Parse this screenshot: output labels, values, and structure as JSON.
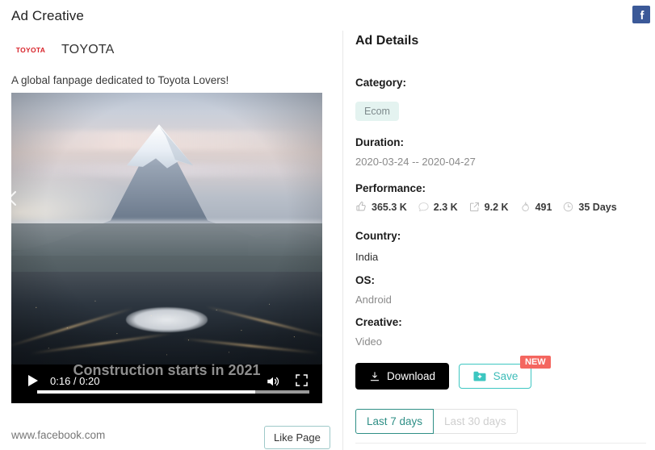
{
  "header": {
    "title": "Ad Creative",
    "social_icon": "facebook-icon"
  },
  "ad_creative": {
    "brand_logo_text": "TOYOTA",
    "brand_name": "TOYOTA",
    "ad_copy": "A global fanpage dedicated to Toyota Lovers!",
    "video": {
      "caption": "Construction starts in 2021",
      "current_time": "0:16",
      "duration": "0:20",
      "time_display": "0:16 / 0:20",
      "progress_percent": 80,
      "play_icon": "play-icon",
      "volume_icon": "volume-icon",
      "fullscreen_icon": "fullscreen-icon"
    },
    "footer": {
      "site_url": "www.facebook.com",
      "cta_label": "Like Page"
    },
    "carousel_prev_icon": "chevron-left-icon"
  },
  "ad_details": {
    "title": "Ad Details",
    "fields": {
      "category_label": "Category:",
      "category_value": "Ecom",
      "duration_label": "Duration:",
      "duration_value": "2020-03-24 -- 2020-04-27",
      "performance_label": "Performance:",
      "country_label": "Country:",
      "country_value": "India",
      "os_label": "OS:",
      "os_value": "Android",
      "creative_label": "Creative:",
      "creative_value": "Video"
    },
    "performance": [
      {
        "icon": "thumbs-up-icon",
        "value": "365.3 K"
      },
      {
        "icon": "comment-icon",
        "value": "2.3 K"
      },
      {
        "icon": "share-icon",
        "value": "9.2 K"
      },
      {
        "icon": "fire-icon",
        "value": "491"
      },
      {
        "icon": "clock-icon",
        "value": "35 Days"
      }
    ],
    "actions": {
      "download_label": "Download",
      "download_icon": "download-icon",
      "save_label": "Save",
      "save_icon": "folder-plus-icon",
      "new_badge": "NEW"
    },
    "date_range": {
      "option_active": "Last 7 days",
      "option_inactive": "Last 30 days"
    }
  },
  "colors": {
    "accent_teal": "#3cbcb8",
    "accent_dark_teal": "#2f8f86",
    "badge_red": "#f4665f",
    "tag_bg": "#e4f3f0",
    "facebook_blue": "#3b5998",
    "toyota_red": "#d8232a"
  }
}
